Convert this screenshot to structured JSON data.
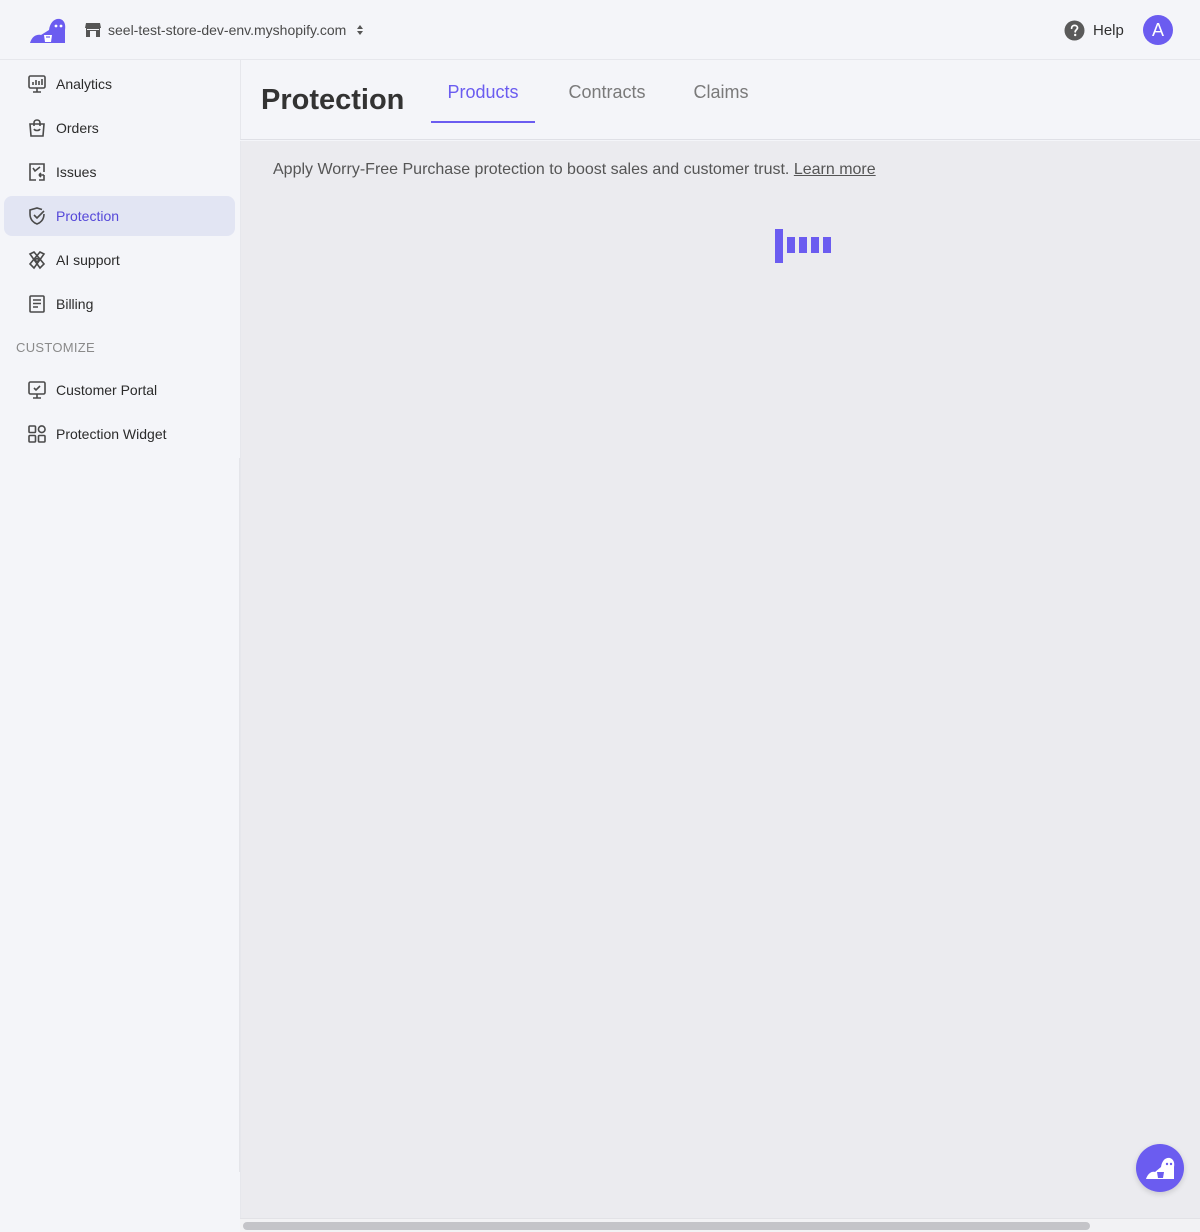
{
  "brand": {
    "accent": "#6b5cf0",
    "logo_icon": "seel-mascot-logo-icon"
  },
  "topbar": {
    "store_name": "seel-test-store-dev-env.myshopify.com",
    "store_icon": "store-icon",
    "caret_icon": "chevron-up-down-icon",
    "help_label": "Help",
    "help_icon": "question-circle-icon",
    "avatar_initial": "A"
  },
  "sidebar": {
    "items": [
      {
        "label": "Analytics",
        "icon": "analytics-icon",
        "active": false
      },
      {
        "label": "Orders",
        "icon": "shopping-bag-icon",
        "active": false
      },
      {
        "label": "Issues",
        "icon": "issue-report-icon",
        "active": false
      },
      {
        "label": "Protection",
        "icon": "shield-check-icon",
        "active": true
      },
      {
        "label": "AI support",
        "icon": "ai-support-icon",
        "active": false
      },
      {
        "label": "Billing",
        "icon": "document-icon",
        "active": false
      }
    ],
    "section_title": "CUSTOMIZE",
    "customize_items": [
      {
        "label": "Customer Portal",
        "icon": "monitor-icon"
      },
      {
        "label": "Protection Widget",
        "icon": "grid-icon"
      }
    ]
  },
  "header": {
    "title": "Protection",
    "tabs": [
      {
        "label": "Products",
        "active": true
      },
      {
        "label": "Contracts",
        "active": false
      },
      {
        "label": "Claims",
        "active": false
      }
    ]
  },
  "main": {
    "intro_text": "Apply Worry-Free Purchase protection to boost sales and customer trust.",
    "learn_more": "Learn more",
    "loading_icon": "loading-bars-icon"
  },
  "fab": {
    "icon": "seel-mascot-chat-icon"
  }
}
